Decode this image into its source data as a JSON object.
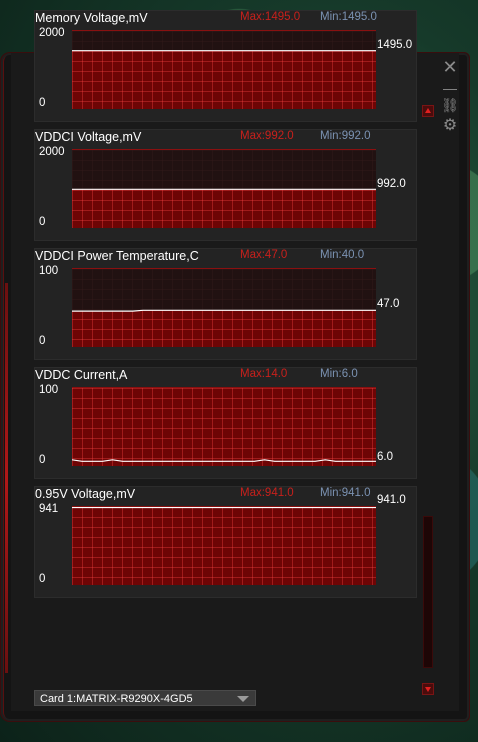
{
  "window": {
    "controls": {
      "close_icon": "✕",
      "minimize_icon": "—",
      "link_icon": "⛓",
      "gear_icon": "⚙"
    }
  },
  "panels": [
    {
      "title": "Memory Voltage,mV",
      "max_label": "Max:1495.0",
      "min_label": "Min:1495.0",
      "axis_top": "2000",
      "axis_bottom": "0",
      "current": "1495.0",
      "fill_from_line": true,
      "values": [
        1495,
        1495,
        1495,
        1495,
        1495,
        1495,
        1495,
        1495,
        1495,
        1495,
        1495,
        1495,
        1495,
        1495,
        1495,
        1495,
        1495,
        1495,
        1495,
        1495,
        1495,
        1495,
        1495,
        1495,
        1495,
        1495,
        1495,
        1495,
        1495,
        1495,
        1495
      ]
    },
    {
      "title": "VDDCI Voltage,mV",
      "max_label": "Max:992.0",
      "min_label": "Min:992.0",
      "axis_top": "2000",
      "axis_bottom": "0",
      "current": "992.0",
      "fill_from_line": true,
      "values": [
        992,
        992,
        992,
        992,
        992,
        992,
        992,
        992,
        992,
        992,
        992,
        992,
        992,
        992,
        992,
        992,
        992,
        992,
        992,
        992,
        992,
        992,
        992,
        992,
        992,
        992,
        992,
        992,
        992,
        992,
        992
      ]
    },
    {
      "title": "VDDCI Power Temperature,C",
      "max_label": "Max:47.0",
      "min_label": "Min:40.0",
      "axis_top": "100",
      "axis_bottom": "0",
      "current": "47.0",
      "fill_from_line": true,
      "values": [
        46,
        46,
        46,
        46,
        46,
        46,
        46,
        47,
        47,
        47,
        47,
        47,
        47,
        47,
        47,
        47,
        47,
        47,
        47,
        47,
        47,
        47,
        47,
        47,
        47,
        47,
        47,
        47,
        47,
        47,
        47
      ]
    },
    {
      "title": "VDDC Current,A",
      "max_label": "Max:14.0",
      "min_label": "Min:6.0",
      "axis_top": "100",
      "axis_bottom": "0",
      "current": "6.0",
      "fill_from_line": false,
      "values": [
        8,
        6,
        6,
        6,
        8,
        6,
        6,
        6,
        6,
        6,
        6,
        6,
        6,
        6,
        6,
        6,
        6,
        6,
        6,
        8,
        6,
        6,
        6,
        6,
        6,
        8,
        6,
        6,
        6,
        6,
        6
      ]
    },
    {
      "title": "0.95V Voltage,mV",
      "max_label": "Max:941.0",
      "min_label": "Min:941.0",
      "axis_top": "941",
      "axis_bottom": "0",
      "current": "941.0",
      "fill_from_line": true,
      "values": [
        941,
        941,
        941,
        941,
        941,
        941,
        941,
        941,
        941,
        941,
        941,
        941,
        941,
        941,
        941,
        941,
        941,
        941,
        941,
        941,
        941,
        941,
        941,
        941,
        941,
        941,
        941,
        941,
        941,
        941,
        941
      ]
    }
  ],
  "card_select": {
    "label": "Card 1:MATRIX-R9290X-4GD5"
  }
}
